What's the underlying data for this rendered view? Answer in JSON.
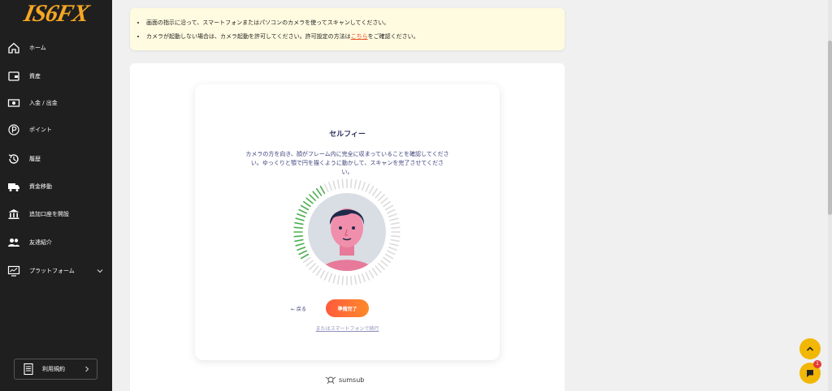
{
  "brand": {
    "logo": "IS6FX",
    "accent": "#f5a623"
  },
  "sidebar": {
    "items": [
      {
        "label": "ホーム",
        "icon": "home-icon"
      },
      {
        "label": "資産",
        "icon": "wallet-icon"
      },
      {
        "label": "入金 / 出金",
        "icon": "cash-icon"
      },
      {
        "label": "ポイント",
        "icon": "points-icon"
      },
      {
        "label": "履歴",
        "icon": "history-icon"
      },
      {
        "label": "資金移動",
        "icon": "truck-icon"
      },
      {
        "label": "追加口座を開設",
        "icon": "bank-icon"
      },
      {
        "label": "友達紹介",
        "icon": "users-icon"
      },
      {
        "label": "プラットフォーム",
        "icon": "monitor-icon"
      }
    ],
    "terms_label": "利用規約"
  },
  "notice": {
    "line1": "画面の指示に沿って、スマートフォンまたはパソコンのカメラを使ってスキャンしてください。",
    "line2_before": "カメラが起動しない場合は、カメラ起動を許可してください。許可設定の方法は",
    "line2_link": "こちら",
    "line2_after": "をご確認ください。"
  },
  "selfie": {
    "title": "セルフィー",
    "description": "カメラの方を向き、顔がフレーム内に完全に収まっていることを確認してください。ゆっくりと顎で円を描くように動かして、スキャンを完了させてください。",
    "back_label": "← 戻る",
    "ready_label": "準備完了",
    "phone_link": "またはスマートフォンで続行"
  },
  "footer": {
    "powered_by": "sumsub"
  },
  "chat": {
    "badge_count": "1"
  }
}
